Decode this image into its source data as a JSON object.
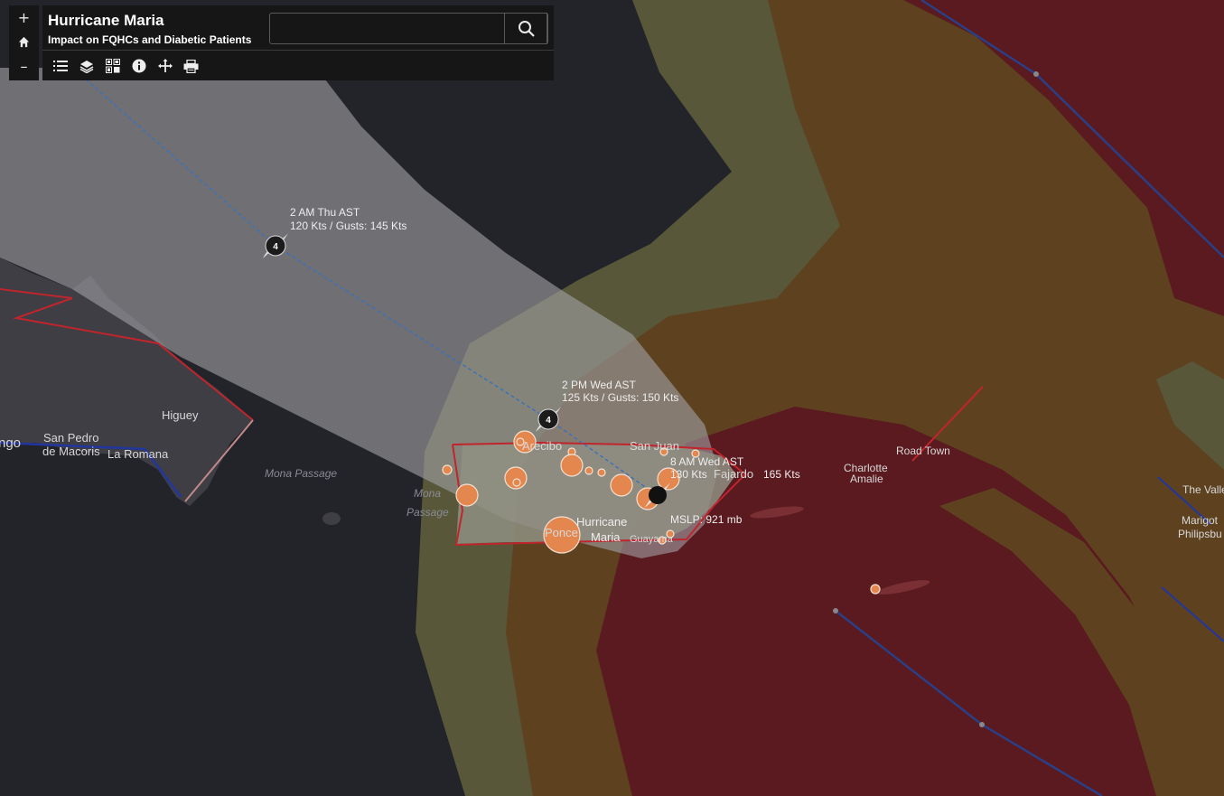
{
  "app": {
    "title": "Hurricane Maria",
    "subtitle": "Impact on FQHCs and Diabetic Patients"
  },
  "search": {
    "value": "",
    "placeholder": ""
  },
  "zoom": {
    "in_label": "+",
    "out_label": "–"
  },
  "toolbar": [
    "legend-icon",
    "layers-icon",
    "basemap-gallery-icon",
    "info-icon",
    "directions-icon",
    "print-icon"
  ],
  "colors": {
    "ocean": "#23232a",
    "land": "#3e3e44",
    "cone": "#9b9b9f",
    "wind_outer": "#585739",
    "wind_mid": "#5e4220",
    "wind_inner": "#5a1a1f",
    "fqhc": "#e3874f",
    "track": "#3d72b8",
    "boundary": "#c0252c"
  },
  "forecast_points": [
    {
      "time": "2 AM Thu AST",
      "wind": "120 Kts / Gusts: 145 Kts",
      "category": "4"
    },
    {
      "time": "2 PM Wed AST",
      "wind": "125 Kts / Gusts: 150 Kts",
      "category": "4"
    },
    {
      "time": "8 AM Wed AST",
      "wind": "130 Kts",
      "gusts": "165 Kts",
      "category": ""
    }
  ],
  "storm": {
    "name_1": "Hurricane",
    "name_2": "Maria",
    "pressure": "MSLP: 921 mb"
  },
  "places": {
    "ngo": "ngo",
    "san_pedro_1": "San Pedro",
    "san_pedro_2": "de Macoris",
    "la_romana": "La Romana",
    "higuey": "Higuey",
    "mona_passage": "Mona Passage",
    "mona_1": "Mona",
    "mona_2": "Passage",
    "arecibo": "Arecibo",
    "san_juan": "San Juan",
    "fajardo": "Fajardo",
    "ponce": "Ponce",
    "guayama": "Guayama",
    "road_town": "Road Town",
    "charlotte_1": "Charlotte",
    "charlotte_2": "Amalie",
    "the_valley": "The Valle",
    "marigot": "Marigot",
    "philipsburg": "Philipsbu"
  }
}
